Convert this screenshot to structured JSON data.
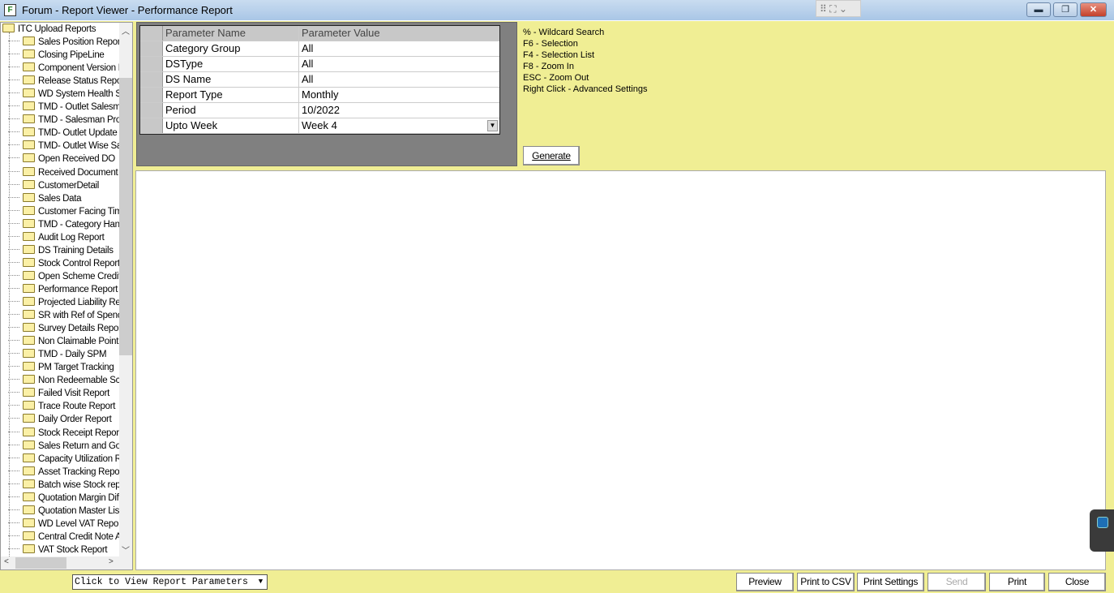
{
  "window": {
    "title": "Forum - Report Viewer - Performance Report",
    "app_icon": "F",
    "min": "minimize-icon",
    "restore": "restore-icon",
    "close": "close-icon"
  },
  "tree": {
    "root": "ITC Upload Reports",
    "selected": "Performance Report",
    "items": [
      "Sales Position Report",
      "Closing PipeLine",
      "Component Version R",
      "Release Status Repo",
      "WD System Health S",
      "TMD - Outlet Salesma",
      "TMD - Salesman Proc",
      "TMD- Outlet Update",
      "TMD- Outlet Wise Sa",
      "Open Received DO",
      "Received Document",
      "CustomerDetail",
      "Sales Data",
      "Customer Facing Time",
      "TMD - Category Hand",
      "Audit Log Report",
      "DS Training Details",
      "Stock Control Report",
      "Open Scheme Credit",
      "Performance Report",
      "Projected Liability Rep",
      "SR with Ref of Spenc",
      "Survey Details Report",
      "Non Claimable Point S",
      "TMD - Daily SPM",
      "PM Target Tracking",
      "Non Redeemable Sch",
      "Failed Visit Report",
      "Trace Route Report",
      "Daily Order Report",
      "Stock Receipt Report",
      "Sales Return and Goo",
      "Capacity Utilization R",
      "Asset Tracking Repor",
      "Batch wise Stock rep",
      "Quotation Margin Diffe",
      "Quotation Master List",
      "WD Level VAT Repo",
      "Central Credit Note Ac",
      "VAT Stock Report"
    ]
  },
  "params": {
    "headers": {
      "name": "Parameter Name",
      "value": "Parameter Value"
    },
    "rows": [
      {
        "name": "Category Group",
        "value": "All"
      },
      {
        "name": "DSType",
        "value": "All"
      },
      {
        "name": "DS Name",
        "value": "All"
      },
      {
        "name": "Report Type",
        "value": "Monthly"
      },
      {
        "name": "Period",
        "value": "10/2022"
      },
      {
        "name": "Upto Week",
        "value": "Week 4"
      }
    ]
  },
  "hints": [
    "% - Wildcard Search",
    "F6 - Selection",
    "F4 - Selection List",
    "F8 - Zoom In",
    "ESC - Zoom Out",
    "Right Click - Advanced Settings"
  ],
  "generate_label": "Generate",
  "footer": {
    "combo_value": "Click to View Report Parameters",
    "buttons": {
      "preview": "Preview",
      "csv": "Print to CSV",
      "settings": "Print Settings",
      "send": "Send",
      "print": "Print",
      "close": "Close"
    }
  },
  "colors": {
    "panel": "#f0ee94",
    "grid_bg": "#808080"
  }
}
